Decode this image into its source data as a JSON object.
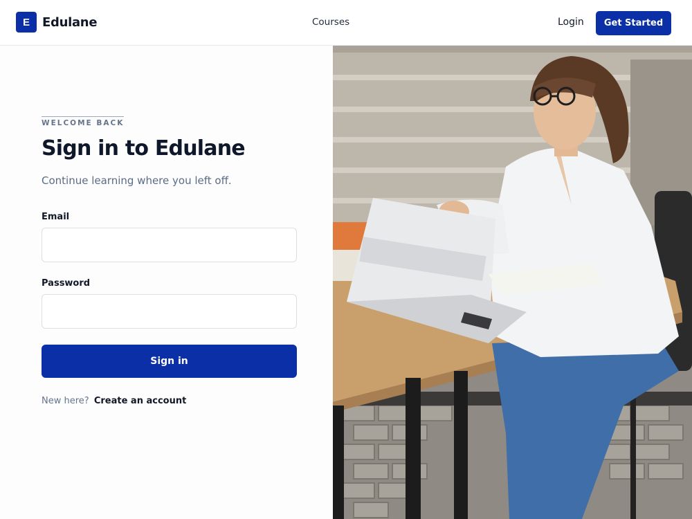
{
  "header": {
    "logo_letter": "E",
    "brand_name": "Edulane",
    "nav_courses": "Courses",
    "login": "Login",
    "get_started": "Get Started"
  },
  "signin": {
    "eyebrow": "WELCOME BACK",
    "title": "Sign in to Edulane",
    "subtitle": "Continue learning where you left off.",
    "email_label": "Email",
    "email_value": "",
    "email_placeholder": "",
    "password_label": "Password",
    "password_value": "",
    "password_placeholder": "",
    "submit_label": "Sign in",
    "signup_prompt": "New here?",
    "signup_link": "Create an account"
  },
  "colors": {
    "brand": "#0b2fa6",
    "text_dark": "#0f172a",
    "text_muted": "#5b6b86"
  },
  "hero_image": {
    "icon": "photo-woman-laptop"
  }
}
